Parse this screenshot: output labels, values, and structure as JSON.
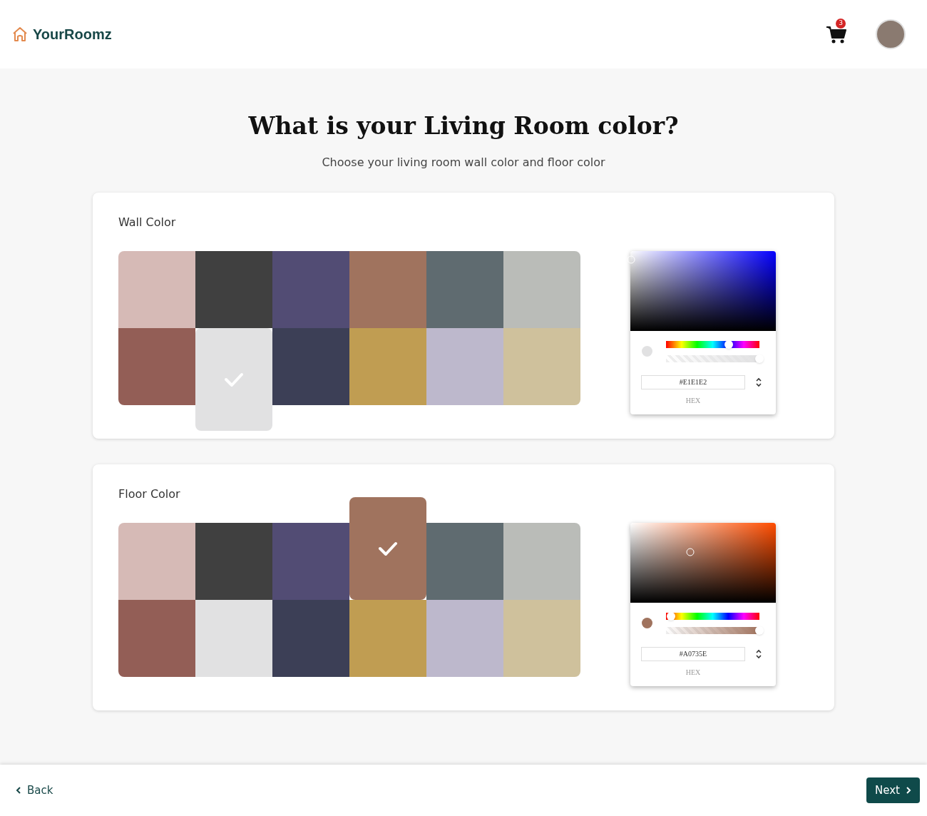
{
  "header": {
    "brand": "YourRoomz",
    "cart_count": "3"
  },
  "title": "What is your Living Room color?",
  "subtitle": "Choose your living room wall color and floor color",
  "sections": [
    {
      "label": "Wall Color",
      "swatches": [
        {
          "color": "#d6bab6",
          "selected": false
        },
        {
          "color": "#404040",
          "selected": false
        },
        {
          "color": "#524c74",
          "selected": false
        },
        {
          "color": "#a0735e",
          "selected": false
        },
        {
          "color": "#5f6b70",
          "selected": false
        },
        {
          "color": "#babcb8",
          "selected": false
        },
        {
          "color": "#935e56",
          "selected": false
        },
        {
          "color": "#e1e1e2",
          "selected": true
        },
        {
          "color": "#3c3f56",
          "selected": false
        },
        {
          "color": "#c09d52",
          "selected": false
        },
        {
          "color": "#bdb8cc",
          "selected": false
        },
        {
          "color": "#cfc19c",
          "selected": false
        }
      ],
      "picker": {
        "hue": {
          "level": 0.67
        },
        "alpha": {
          "level": 1
        },
        "hex": "#E1E1E2",
        "format": "HEX"
      }
    },
    {
      "label": "Floor Color",
      "swatches": [
        {
          "color": "#d6bab6",
          "selected": false
        },
        {
          "color": "#404040",
          "selected": false
        },
        {
          "color": "#524c74",
          "selected": false
        },
        {
          "color": "#a0735e",
          "selected": true
        },
        {
          "color": "#5f6b70",
          "selected": false
        },
        {
          "color": "#babcb8",
          "selected": false
        },
        {
          "color": "#935e56",
          "selected": false
        },
        {
          "color": "#e1e1e2",
          "selected": false
        },
        {
          "color": "#3c3f56",
          "selected": false
        },
        {
          "color": "#c09d52",
          "selected": false
        },
        {
          "color": "#bdb8cc",
          "selected": false
        },
        {
          "color": "#cfc19c",
          "selected": false
        }
      ],
      "picker": {
        "hue": {
          "level": 0.05
        },
        "alpha": {
          "level": 1
        },
        "hex": "#A0735E",
        "format": "HEX"
      }
    }
  ],
  "footer": {
    "back": "Back",
    "next": "Next"
  }
}
